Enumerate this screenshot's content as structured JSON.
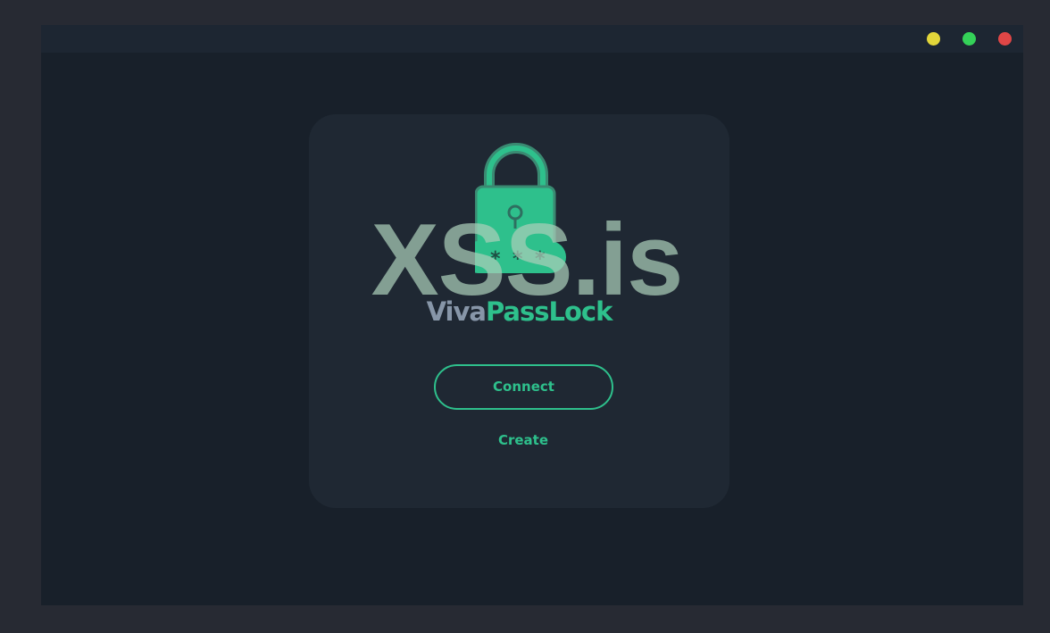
{
  "window": {
    "controls": [
      {
        "name": "minimize",
        "color": "#e2d63a"
      },
      {
        "name": "maximize",
        "color": "#34d158"
      },
      {
        "name": "close",
        "color": "#e04646"
      }
    ]
  },
  "logo": {
    "icon": "padlock-password-icon",
    "brand_part1": "Viva",
    "brand_part2": "PassLock",
    "watermark": "XSS.is"
  },
  "actions": {
    "connect_label": "Connect",
    "create_label": "Create"
  },
  "colors": {
    "accent": "#2ec08c",
    "muted_text": "#8796a8",
    "card_bg": "#1f2833",
    "window_bg": "#18202a"
  }
}
